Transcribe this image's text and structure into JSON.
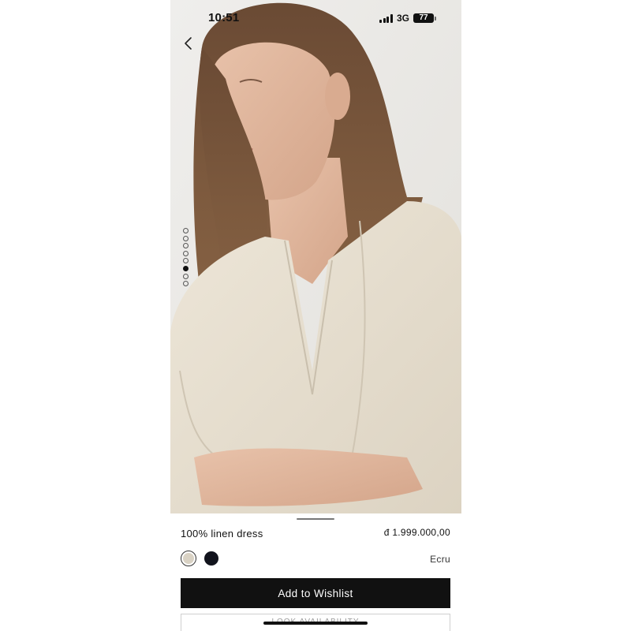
{
  "status_bar": {
    "time": "10:51",
    "network": "3G",
    "battery": "77"
  },
  "gallery": {
    "image": "model-wearing-ecru-linen-dress",
    "dot_count": 8,
    "active_dot_index": 5
  },
  "product": {
    "name": "100% linen dress",
    "price": "đ 1.999.000,00",
    "selected_color": "Ecru",
    "colors": [
      {
        "name": "ecru",
        "hex": "#d9d2c4",
        "selected": true
      },
      {
        "name": "black",
        "hex": "#11131c",
        "selected": false
      }
    ]
  },
  "actions": {
    "wishlist_label": "Add to Wishlist",
    "secondary_label": "LOOK AVAILABILITY"
  },
  "icons": {
    "back": "chevron-left-icon",
    "signal": "signal-bars-icon",
    "battery": "battery-icon"
  },
  "colors": {
    "primary_button": "#111111",
    "background": "#ffffff",
    "photo_background": "#e9e8e4"
  }
}
